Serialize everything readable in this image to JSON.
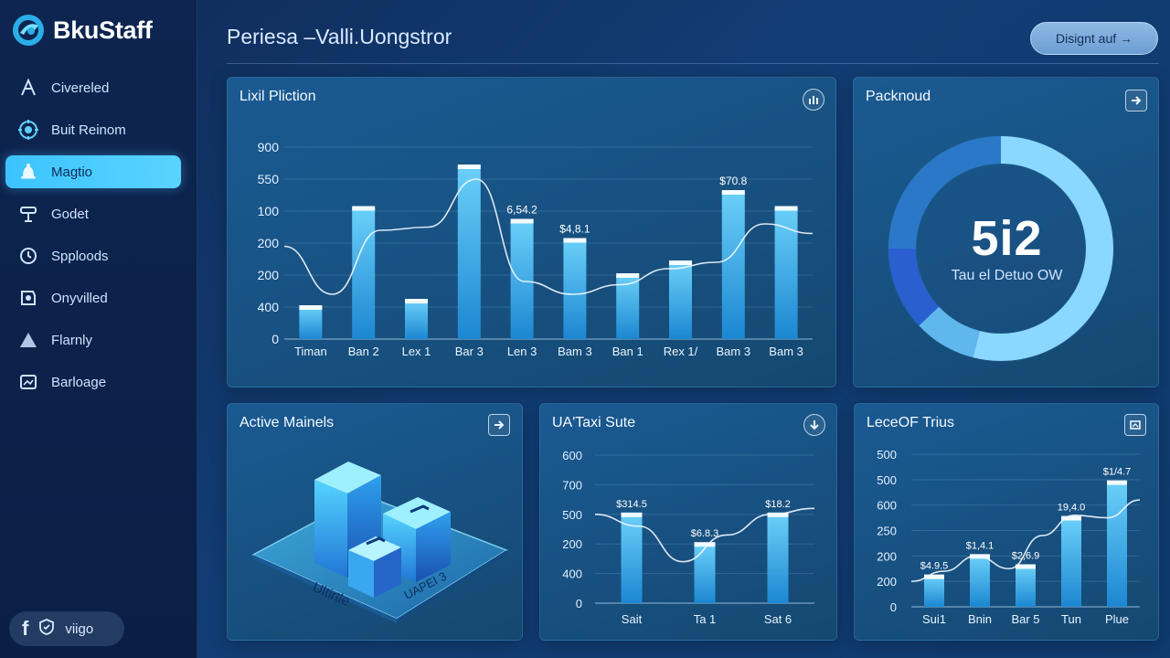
{
  "app": {
    "name": "BkuStaff"
  },
  "sidebar": {
    "items": [
      {
        "label": "Civereled",
        "icon": "letter-a-icon",
        "active": false
      },
      {
        "label": "Buit Reinom",
        "icon": "target-icon",
        "active": false
      },
      {
        "label": "Magtio",
        "icon": "bell-icon",
        "active": true
      },
      {
        "label": "Godet",
        "icon": "tools-icon",
        "active": false
      },
      {
        "label": "Spploods",
        "icon": "refresh-icon",
        "active": false
      },
      {
        "label": "Onyvilled",
        "icon": "shield-icon",
        "active": false
      },
      {
        "label": "Flarnly",
        "icon": "triangle-icon",
        "active": false
      },
      {
        "label": "Barloage",
        "icon": "image-icon",
        "active": false
      }
    ],
    "social_label": "viigo"
  },
  "header": {
    "title": "Periesa –Valli.Uongstror",
    "button_label": "Disignt auf →"
  },
  "colors": {
    "accent": "#3cc4ff",
    "bar_top": "#6fd6ff",
    "bar_bottom": "#1c8ad6",
    "ring_light": "#8ad8ff",
    "ring_dark": "#2a5fd0"
  },
  "cards": {
    "main_chart": {
      "title": "Lixil Pliction",
      "action_icon": "settings-icon"
    },
    "packnoud": {
      "title": "Packnoud",
      "action_icon": "arrow-right-icon",
      "value": "5i2",
      "subtitle": "Tau el Detuo OW"
    },
    "active": {
      "title": "Active Mainels",
      "action_icon": "arrow-right-icon",
      "label_a": "Ultirtle",
      "label_b": "UAPEI 3"
    },
    "taxi": {
      "title": "UA'Taxi Sute",
      "action_icon": "download-icon"
    },
    "trius": {
      "title": "LeceOF Trius",
      "action_icon": "image-icon"
    }
  },
  "chart_data": [
    {
      "id": "main",
      "type": "bar",
      "categories": [
        "Timan",
        "Ban 2",
        "Lex 1",
        "Bar 3",
        "Len 3",
        "Bam 3",
        "Ban 1",
        "Rex 1/",
        "Bam 3",
        "Bam 3"
      ],
      "yticks": [
        "0",
        "400",
        "200",
        "200",
        "100",
        "550",
        "900"
      ],
      "values": [
        1,
        4.1,
        1.2,
        5.4,
        3.7,
        3.1,
        2,
        2.4,
        4.6,
        4.1
      ],
      "line": [
        2.9,
        1.4,
        3.4,
        3.5,
        5.0,
        1.8,
        1.4,
        1.7,
        2.2,
        2.4,
        3.6,
        3.3
      ],
      "data_labels": [
        {
          "index": 4,
          "text": "6,54.2"
        },
        {
          "index": 5,
          "text": "$4,8.1"
        },
        {
          "index": 8,
          "text": "$70.8"
        }
      ],
      "ylim": [
        0,
        6
      ]
    },
    {
      "id": "taxi",
      "type": "bar",
      "categories": [
        "Sait",
        "Ta 1",
        "Sat 6"
      ],
      "yticks": [
        "0",
        "400",
        "200",
        "500",
        "700",
        "600"
      ],
      "values": [
        3.0,
        2.0,
        3.0
      ],
      "line": [
        3.0,
        2.6,
        1.4,
        2.3,
        3.0,
        3.2
      ],
      "data_labels": [
        {
          "index": 0,
          "text": "$314.5"
        },
        {
          "index": 1,
          "text": "$6.8.3"
        },
        {
          "index": 2,
          "text": "$18.2"
        }
      ],
      "ylim": [
        0,
        5
      ]
    },
    {
      "id": "trius",
      "type": "bar",
      "categories": [
        "Sui1",
        "Bnin",
        "Bar 5",
        "Tun",
        "Plue"
      ],
      "yticks": [
        "0",
        "200",
        "200",
        "250",
        "600",
        "500",
        "500"
      ],
      "values": [
        1.2,
        2.0,
        1.6,
        3.5,
        4.9
      ],
      "line": [
        1.0,
        1.4,
        2.0,
        1.5,
        2.8,
        3.6,
        3.5,
        4.2
      ],
      "data_labels": [
        {
          "index": 0,
          "text": "$4.9.5"
        },
        {
          "index": 1,
          "text": "$1,4.1"
        },
        {
          "index": 2,
          "text": "$2,6.9"
        },
        {
          "index": 3,
          "text": "19,4.0"
        },
        {
          "index": 4,
          "text": "$1/4.7"
        }
      ],
      "ylim": [
        0,
        6
      ]
    }
  ],
  "donut": {
    "segments": [
      {
        "value": 54,
        "color": "#8ad8ff"
      },
      {
        "value": 9,
        "color": "#5fb7ee"
      },
      {
        "value": 12,
        "color": "#2a5fd0"
      },
      {
        "value": 25,
        "color": "#2b78c8"
      }
    ]
  }
}
